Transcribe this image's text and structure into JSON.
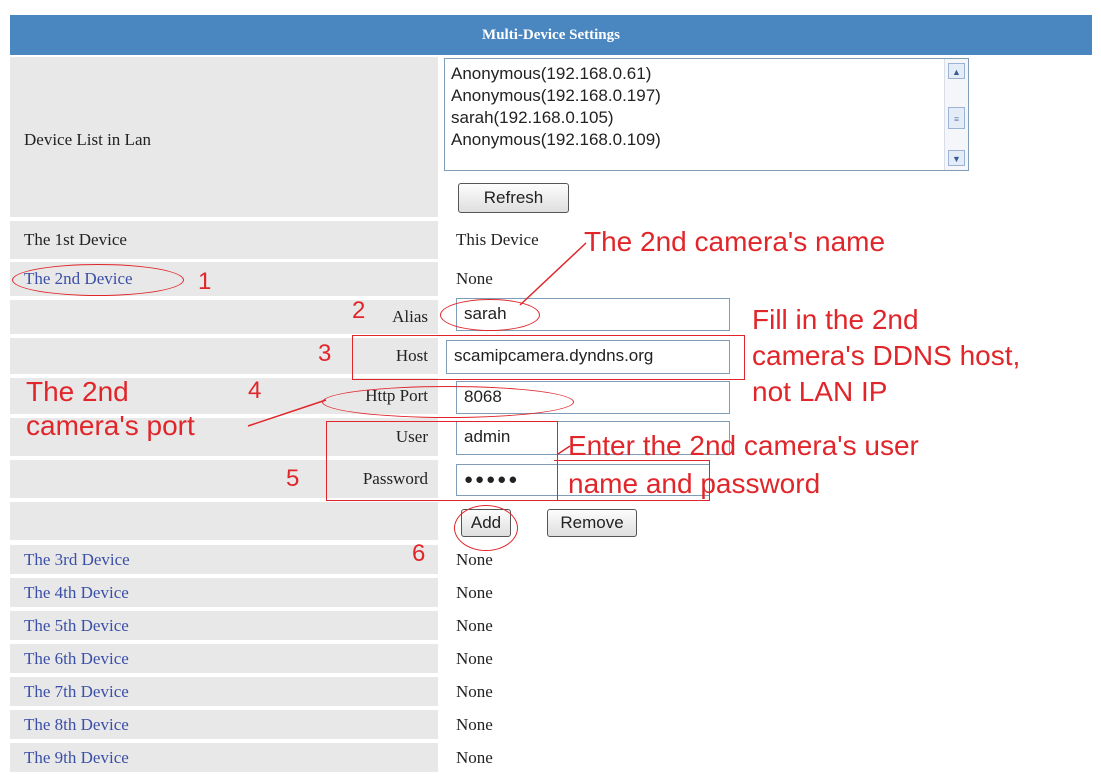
{
  "header": {
    "title": "Multi-Device Settings"
  },
  "device_list": {
    "label": "Device List in Lan",
    "items": [
      "Anonymous(192.168.0.61)",
      "Anonymous(192.168.0.197)",
      "sarah(192.168.0.105)",
      "Anonymous(192.168.0.109)"
    ],
    "refresh_label": "Refresh"
  },
  "first_device": {
    "label": "The 1st Device",
    "value": "This Device"
  },
  "second_device": {
    "label": "The 2nd Device",
    "value": "None"
  },
  "form": {
    "alias_label": "Alias",
    "alias_value": "sarah",
    "host_label": "Host",
    "host_value": "scamipcamera.dyndns.org",
    "port_label": "Http Port",
    "port_value": "8068",
    "user_label": "User",
    "user_value": "admin",
    "password_label": "Password",
    "password_value": "●●●●●",
    "add_label": "Add",
    "remove_label": "Remove"
  },
  "other_devices": [
    {
      "label": "The 3rd Device",
      "value": "None"
    },
    {
      "label": "The 4th Device",
      "value": "None"
    },
    {
      "label": "The 5th Device",
      "value": "None"
    },
    {
      "label": "The 6th Device",
      "value": "None"
    },
    {
      "label": "The 7th Device",
      "value": "None"
    },
    {
      "label": "The 8th Device",
      "value": "None"
    },
    {
      "label": "The 9th Device",
      "value": "None"
    }
  ],
  "annotations": {
    "num1": "1",
    "num2": "2",
    "num3": "3",
    "num4": "4",
    "num5": "5",
    "num6": "6",
    "name_note": "The 2nd camera's name",
    "host_note_1": "Fill in the 2nd",
    "host_note_2": "camera's DDNS host,",
    "host_note_3": "not LAN IP",
    "port_note_1": "The 2nd",
    "port_note_2": "camera's port",
    "user_note_1": "Enter the 2nd camera's user",
    "user_note_2": "name and password"
  },
  "colors": {
    "header_bg": "#4a86c0",
    "label_bg": "#e8e8e8",
    "link": "#3a4fa8",
    "annotation": "#e0262a"
  }
}
